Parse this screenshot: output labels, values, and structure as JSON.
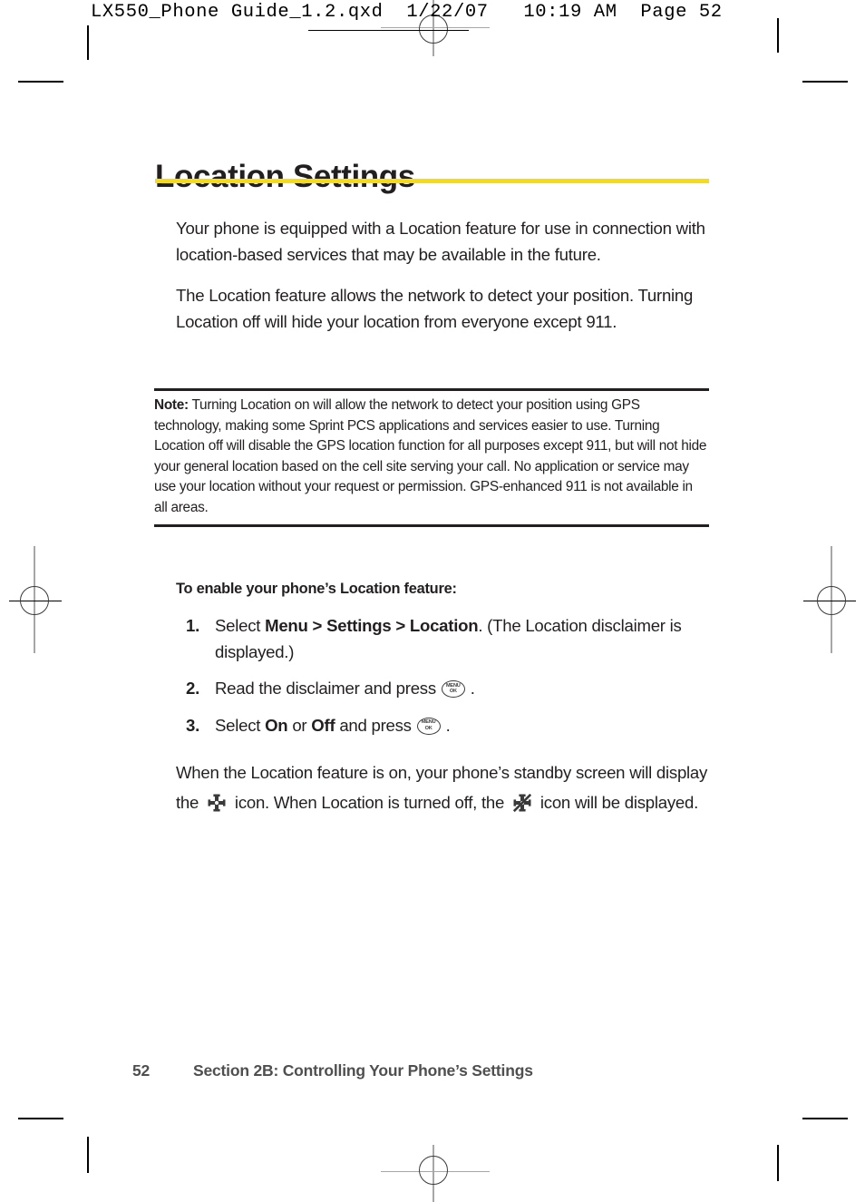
{
  "slug": {
    "text": "LX550_Phone Guide_1.2.qxd  1/22/07   10:19 AM  Page 52"
  },
  "document": {
    "title": "Location Settings",
    "title_rule_color": "#F9DC0C",
    "intro_paragraphs": [
      "Your phone is equipped with a Location feature for use in connection with location-based services that may be available in the future.",
      "The Location feature allows the network to detect your position. Turning Location off will hide your location from everyone except 911."
    ],
    "note": {
      "label": "Note:",
      "text": " Turning Location on will allow the network to detect your position using GPS technology, making some Sprint PCS applications and services easier to use. Turning Location off will disable the GPS location function for all purposes except 911, but will not hide your general location based on the cell site serving your call. No application or service may use your location without your request or permission. GPS-enhanced 911 is not available in all areas."
    },
    "procedure": {
      "heading": "To enable your phone’s Location feature:",
      "steps": [
        {
          "number": "1.",
          "text_before": "Select ",
          "bold": "Menu > Settings > Location",
          "text_after": ". (The Location disclaimer is displayed.)"
        },
        {
          "number": "2.",
          "text_before": "Read the disclaimer and press ",
          "bold": "",
          "text_after": " ."
        },
        {
          "number": "3.",
          "text_before": "Select ",
          "bold": "On",
          "text_mid": " or ",
          "bold2": "Off",
          "text_after": " and press ",
          "text_end": " ."
        }
      ]
    },
    "closing": {
      "part1": "When the Location feature is on, your phone’s standby screen will display the ",
      "part2": " icon. When Location is turned off, the ",
      "part3": " icon will be displayed."
    }
  },
  "icons": {
    "menu_ok_top": "MENU",
    "menu_ok_bottom": "OK",
    "location_on": "location-on-icon",
    "location_off": "location-off-icon"
  },
  "footer": {
    "page_number": "52",
    "section": "Section 2B: Controlling Your Phone’s Settings"
  }
}
